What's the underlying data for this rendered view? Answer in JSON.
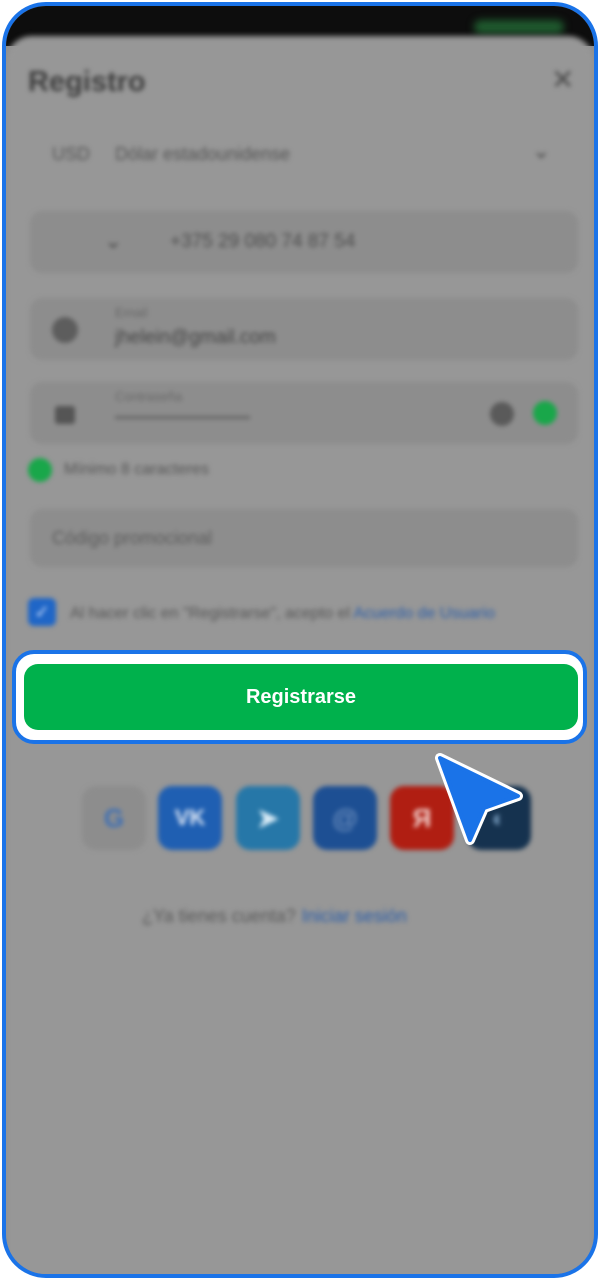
{
  "form": {
    "title": "Registro",
    "currency_code": "USD",
    "currency_name": "Dólar estadounidense",
    "phone_number": "+375 29 080 74 87 54",
    "email_label": "Email",
    "email_value": "jhelein@gmail.com",
    "password_label": "Contraseña",
    "password_rule": "Mínimo 8 caracteres",
    "promo_placeholder": "Código promocional",
    "agree_text": "Al hacer clic en \"Registrarse\", acepto el",
    "agree_link": "Acuerdo de Usuario",
    "submit_label": "Registrarse"
  },
  "social": {
    "google_glyph": "G",
    "vk_glyph": "VK",
    "telegram_glyph": "➤",
    "mail_glyph": "@",
    "yandex_glyph": "Я",
    "steam_glyph": "◐"
  },
  "footer": {
    "question": "¿Ya tienes cuenta?",
    "login_link": "Iniciar sesión"
  },
  "colors": {
    "highlight": "#1a73e8",
    "submit": "#00b14c"
  }
}
